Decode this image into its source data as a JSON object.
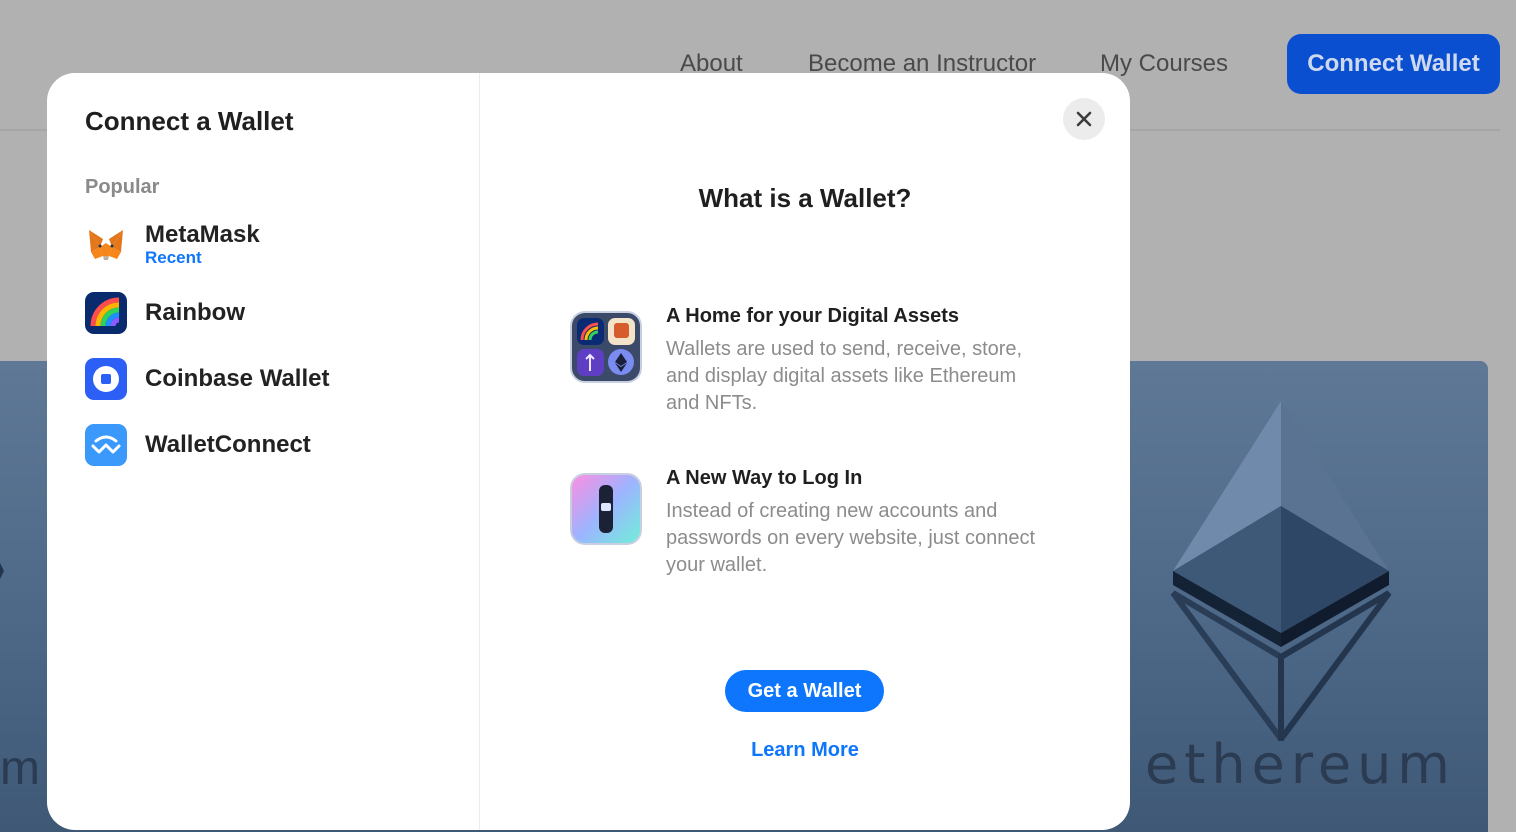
{
  "nav": {
    "links": [
      "About",
      "Become an Instructor",
      "My Courses"
    ],
    "connect_label": "Connect Wallet"
  },
  "hero": {
    "left_text": "m",
    "right_text": "ethereum"
  },
  "modal": {
    "title": "Connect a Wallet",
    "section_label": "Popular",
    "wallets": [
      {
        "name": "MetaMask",
        "sub": "Recent",
        "icon": "metamask-fox-icon"
      },
      {
        "name": "Rainbow",
        "sub": "",
        "icon": "rainbow-icon"
      },
      {
        "name": "Coinbase Wallet",
        "sub": "",
        "icon": "coinbase-icon"
      },
      {
        "name": "WalletConnect",
        "sub": "",
        "icon": "walletconnect-icon"
      }
    ],
    "close_icon": "close-icon",
    "what_title": "What is a Wallet?",
    "info": [
      {
        "heading": "A Home for your Digital Assets",
        "body": "Wallets are used to send, receive, store, and display digital assets like Ethereum and NFTs.",
        "icon": "digital-assets-icon"
      },
      {
        "heading": "A New Way to Log In",
        "body": "Instead of creating new accounts and passwords on every website, just connect your wallet.",
        "icon": "login-key-icon"
      }
    ],
    "get_wallet_label": "Get a Wallet",
    "learn_more_label": "Learn More"
  },
  "colors": {
    "accent": "#0e76fd",
    "nav_button": "#0a4fd0",
    "overlay": "#b1b1b1"
  }
}
